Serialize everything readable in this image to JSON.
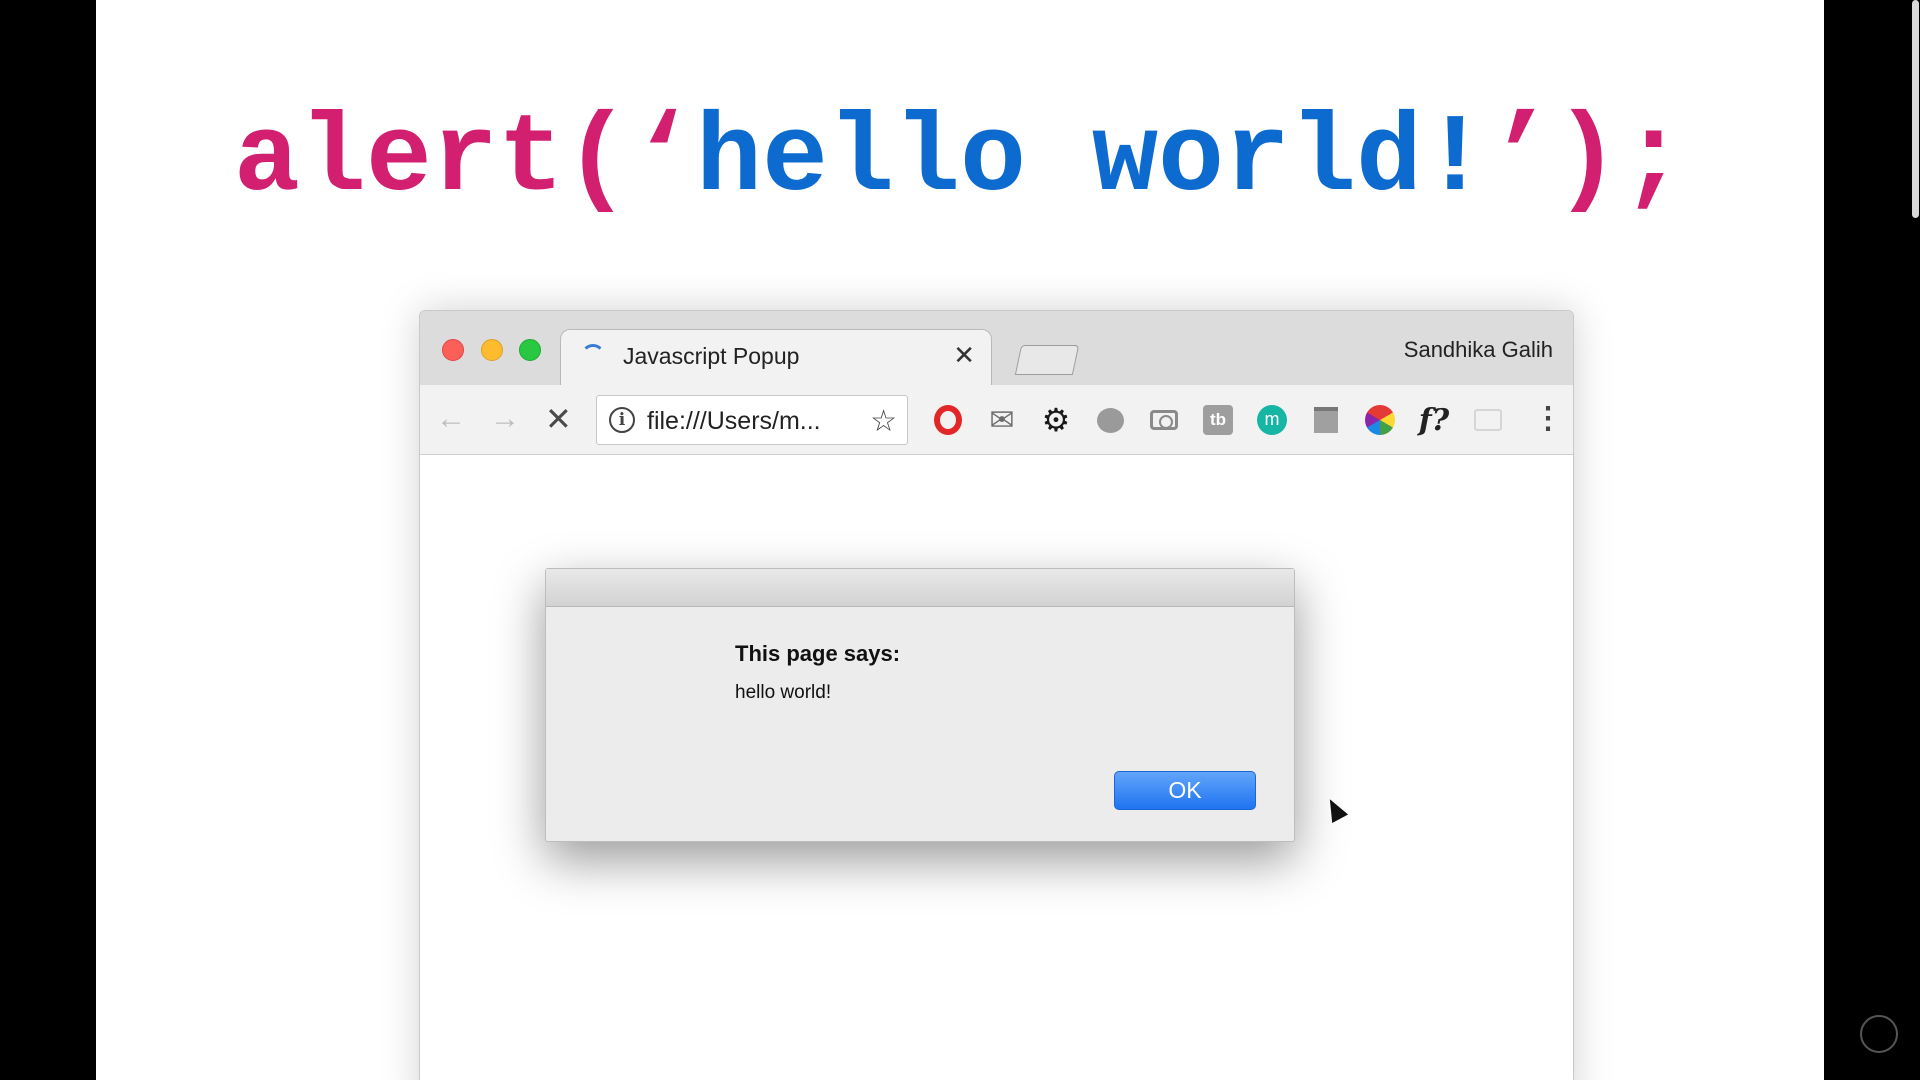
{
  "slide": {
    "code": {
      "prefix": "alert(",
      "quote_open": "‘",
      "message": "hello world!",
      "quote_close": "’",
      "suffix": ");",
      "colors": {
        "syntax": "#d21f70",
        "string": "#0d6bd0"
      }
    }
  },
  "browser": {
    "tab": {
      "title": "Javascript Popup",
      "close_icon": "✕"
    },
    "profile_name": "Sandhika Galih",
    "toolbar": {
      "back_icon": "←",
      "forward_icon": "→",
      "stop_icon": "✕",
      "url": "file:///Users/m...",
      "info_icon": "i",
      "star_icon": "☆",
      "gmail_icon": "✉",
      "gear_icon": "⚙",
      "tb_label": "tb",
      "m_label": "m",
      "font_label": "f?",
      "menu_icon": "⋮"
    }
  },
  "dialog": {
    "heading": "This page says:",
    "message": "hello world!",
    "ok_label": "OK"
  }
}
